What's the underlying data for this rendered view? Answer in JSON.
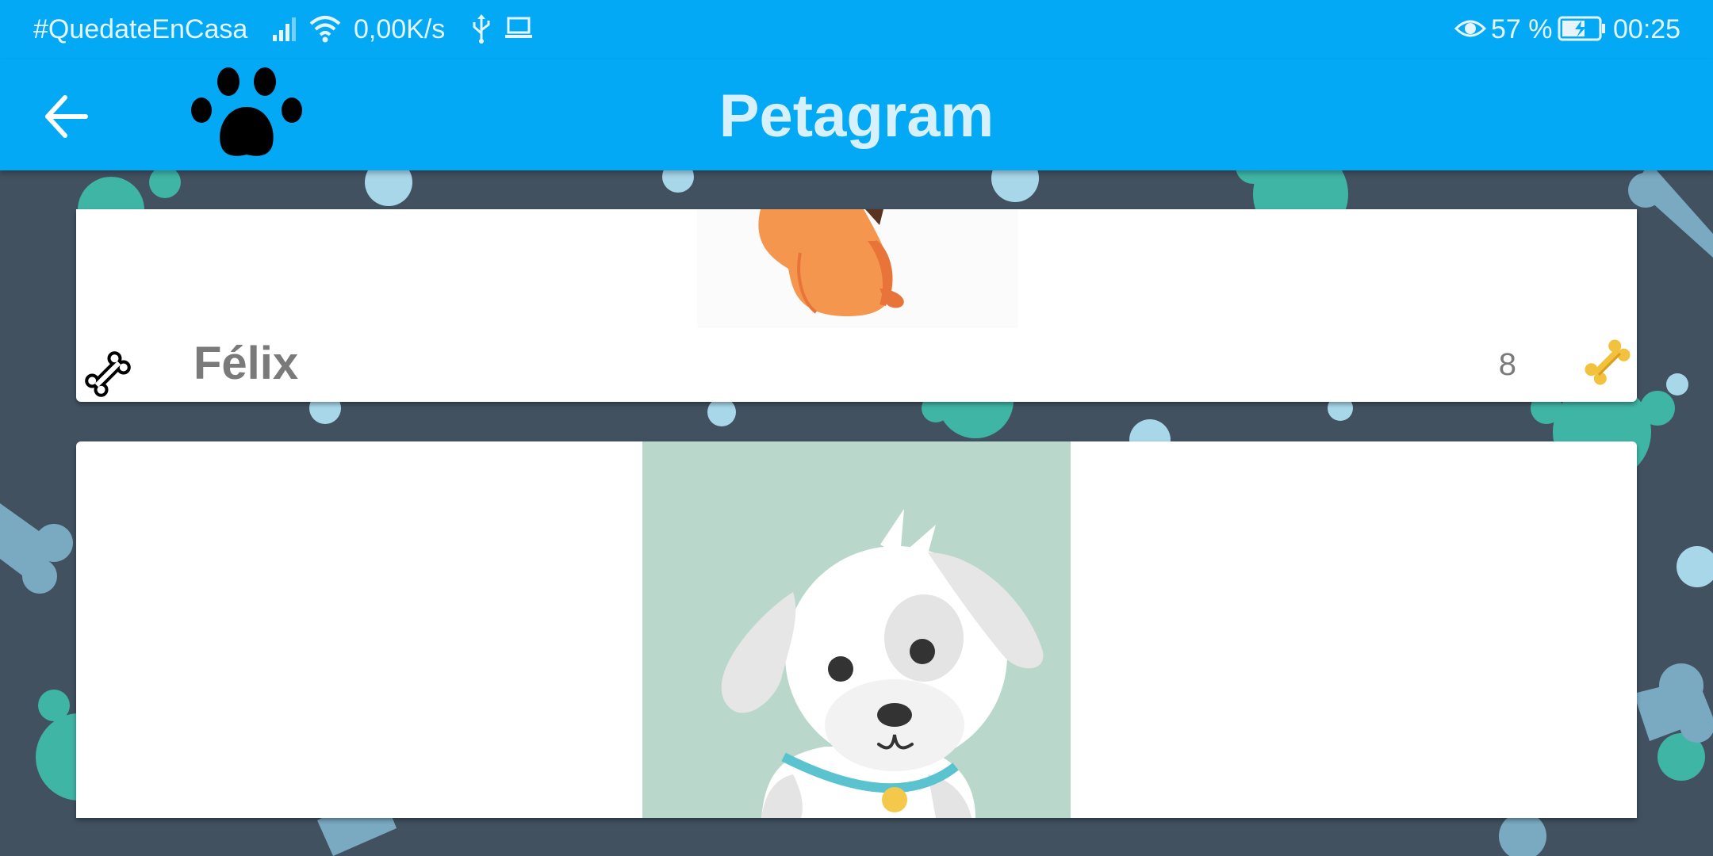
{
  "status_bar": {
    "hashtag": "#QuedateEnCasa",
    "network_speed": "0,00K/s",
    "battery_percent": "57 %",
    "time": "00:25",
    "icons": [
      "signal-icon",
      "wifi-icon",
      "usb-icon",
      "laptop-icon",
      "eye-icon",
      "battery-charging-icon"
    ]
  },
  "app_bar": {
    "title": "Petagram",
    "back_icon": "arrow-left-icon",
    "logo_icon": "paw-icon"
  },
  "pets": [
    {
      "name": "Félix",
      "likes": "8",
      "rate_icon": "bone-outline-icon",
      "like_icon": "bone-icon"
    },
    {
      "name": "",
      "likes": ""
    }
  ],
  "colors": {
    "primary": "#03a9f4",
    "background": "#415160",
    "text_secondary": "#7a7a7a",
    "bone_like": "#f2c13d"
  }
}
